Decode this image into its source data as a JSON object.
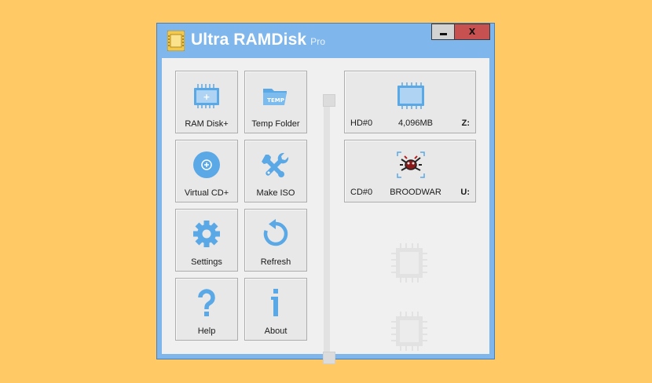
{
  "window": {
    "title": "Ultra RAMDisk",
    "edition": "Pro",
    "close_glyph": "x"
  },
  "tiles": [
    {
      "label": "RAM Disk+",
      "icon": "memory-chip-icon"
    },
    {
      "label": "Temp Folder",
      "icon": "temp-folder-icon"
    },
    {
      "label": "Virtual CD+",
      "icon": "cd-add-icon"
    },
    {
      "label": "Make ISO",
      "icon": "tools-icon"
    },
    {
      "label": "Settings",
      "icon": "gear-icon"
    },
    {
      "label": "Refresh",
      "icon": "refresh-icon"
    },
    {
      "label": "Help",
      "icon": "question-icon"
    },
    {
      "label": "About",
      "icon": "info-icon"
    }
  ],
  "drives": [
    {
      "id": "HD#0",
      "info": "4,096MB",
      "letter": "Z:",
      "icon": "memory-module-icon"
    },
    {
      "id": "CD#0",
      "info": "BROODWAR",
      "letter": "U:",
      "icon": "broodwar-disc-icon"
    }
  ],
  "empty_slots": [
    {
      "icon": "empty-slot-chip-icon"
    },
    {
      "icon": "empty-slot-chip-icon"
    }
  ],
  "colors": {
    "accent": "#7FB6EC",
    "icon_blue": "#5AA8E6",
    "background": "#FFCA66",
    "close_red": "#C75050"
  }
}
